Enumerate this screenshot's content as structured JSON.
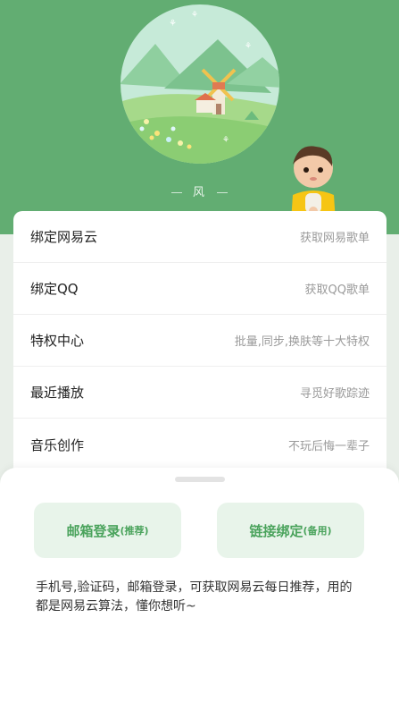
{
  "header": {
    "wind_label": "风",
    "colors": {
      "background": "#62ad72",
      "accent": "#4aa35c"
    }
  },
  "list": {
    "items": [
      {
        "title": "绑定网易云",
        "subtitle": "获取网易歌单"
      },
      {
        "title": "绑定QQ",
        "subtitle": "获取QQ歌单"
      },
      {
        "title": "特权中心",
        "subtitle": "批量,同步,换肤等十大特权"
      },
      {
        "title": "最近播放",
        "subtitle": "寻觅好歌踪迹"
      },
      {
        "title": "音乐创作",
        "subtitle": "不玩后悔一辈子"
      }
    ]
  },
  "sheet": {
    "email_login": {
      "label": "邮箱登录",
      "tag": "(推荐)"
    },
    "link_bind": {
      "label": "链接绑定",
      "tag": "(备用)"
    },
    "description": "手机号,验证码，邮箱登录，可获取网易云每日推荐，用的都是网易云算法，懂你想听~"
  }
}
